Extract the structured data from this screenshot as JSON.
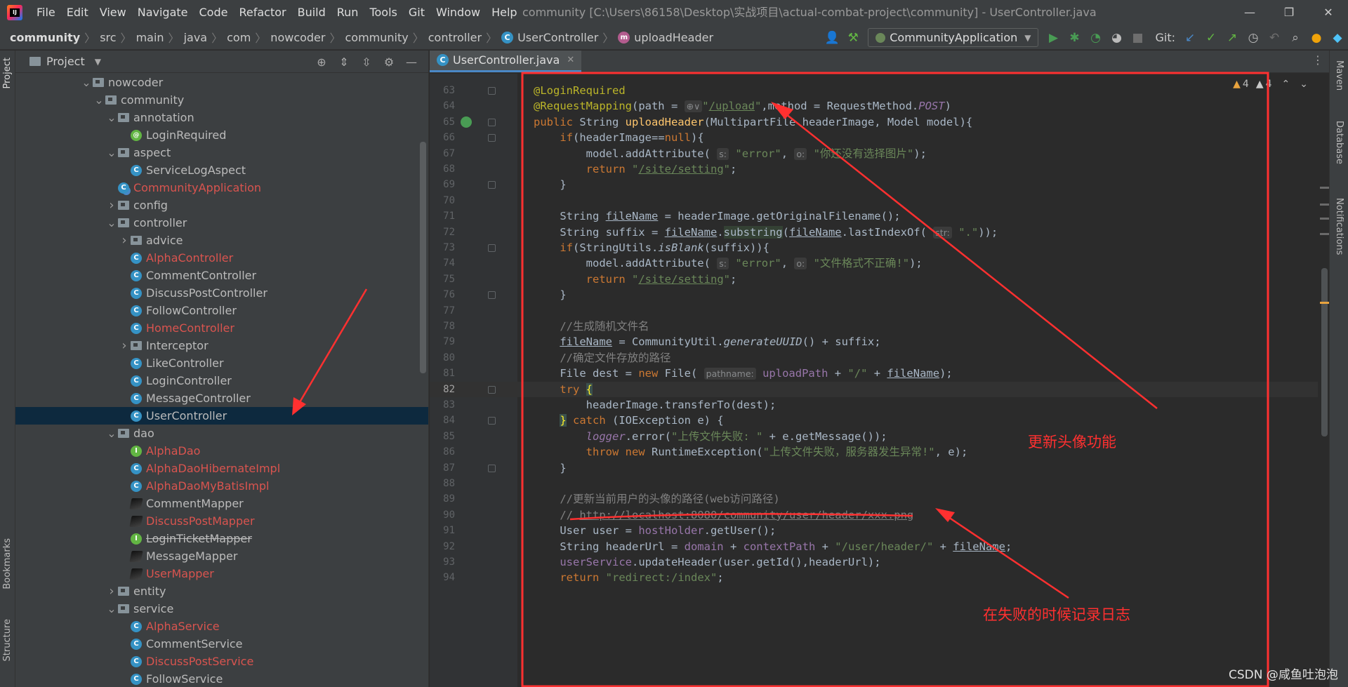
{
  "window": {
    "title": "community [C:\\Users\\86158\\Desktop\\实战项目\\actual-combat-project\\community] - UserController.java",
    "minimize": "—",
    "restore": "❐",
    "close": "✕"
  },
  "menu": [
    "File",
    "Edit",
    "View",
    "Navigate",
    "Code",
    "Refactor",
    "Build",
    "Run",
    "Tools",
    "Git",
    "Window",
    "Help"
  ],
  "breadcrumb": {
    "root": "community",
    "parts": [
      "src",
      "main",
      "java",
      "com",
      "nowcoder",
      "community",
      "controller"
    ],
    "class_name": "UserController",
    "method_name": "uploadHeader"
  },
  "toolbar": {
    "run_config": "CommunityApplication",
    "git_label": "Git:"
  },
  "stripes": {
    "project": "Project",
    "bookmarks": "Bookmarks",
    "structure": "Structure",
    "maven": "Maven",
    "database": "Database",
    "notifications": "Notifications"
  },
  "project_panel": {
    "title": "Project",
    "tree": [
      {
        "label": "nowcoder",
        "icon": "package",
        "depth": 0,
        "arrow": "open"
      },
      {
        "label": "community",
        "icon": "package",
        "depth": 1,
        "arrow": "open"
      },
      {
        "label": "annotation",
        "icon": "package",
        "depth": 2,
        "arrow": "open"
      },
      {
        "label": "LoginRequired",
        "icon": "annotation",
        "depth": 3,
        "arrow": "none"
      },
      {
        "label": "aspect",
        "icon": "package",
        "depth": 2,
        "arrow": "open"
      },
      {
        "label": "ServiceLogAspect",
        "icon": "class",
        "depth": 3,
        "arrow": "none"
      },
      {
        "label": "CommunityApplication",
        "icon": "app",
        "depth": 2,
        "arrow": "none",
        "modified": true
      },
      {
        "label": "config",
        "icon": "package",
        "depth": 2,
        "arrow": "closed"
      },
      {
        "label": "controller",
        "icon": "package",
        "depth": 2,
        "arrow": "open"
      },
      {
        "label": "advice",
        "icon": "package",
        "depth": 3,
        "arrow": "closed"
      },
      {
        "label": "AlphaController",
        "icon": "class",
        "depth": 3,
        "arrow": "none",
        "modified": true
      },
      {
        "label": "CommentController",
        "icon": "class",
        "depth": 3,
        "arrow": "none"
      },
      {
        "label": "DiscussPostController",
        "icon": "class",
        "depth": 3,
        "arrow": "none"
      },
      {
        "label": "FollowController",
        "icon": "class",
        "depth": 3,
        "arrow": "none"
      },
      {
        "label": "HomeController",
        "icon": "class",
        "depth": 3,
        "arrow": "none",
        "modified": true
      },
      {
        "label": "Interceptor",
        "icon": "package",
        "depth": 3,
        "arrow": "closed"
      },
      {
        "label": "LikeController",
        "icon": "class",
        "depth": 3,
        "arrow": "none"
      },
      {
        "label": "LoginController",
        "icon": "class",
        "depth": 3,
        "arrow": "none"
      },
      {
        "label": "MessageController",
        "icon": "class",
        "depth": 3,
        "arrow": "none"
      },
      {
        "label": "UserController",
        "icon": "class",
        "depth": 3,
        "arrow": "none",
        "selected": true
      },
      {
        "label": "dao",
        "icon": "package",
        "depth": 2,
        "arrow": "open"
      },
      {
        "label": "AlphaDao",
        "icon": "interface",
        "depth": 3,
        "arrow": "none",
        "modified": true
      },
      {
        "label": "AlphaDaoHibernateImpl",
        "icon": "class",
        "depth": 3,
        "arrow": "none",
        "modified": true
      },
      {
        "label": "AlphaDaoMyBatisImpl",
        "icon": "class",
        "depth": 3,
        "arrow": "none",
        "modified": true
      },
      {
        "label": "CommentMapper",
        "icon": "mapper",
        "depth": 3,
        "arrow": "none"
      },
      {
        "label": "DiscussPostMapper",
        "icon": "mapper",
        "depth": 3,
        "arrow": "none",
        "modified": true
      },
      {
        "label": "LoginTicketMapper",
        "icon": "interface",
        "depth": 3,
        "arrow": "none",
        "strike": true
      },
      {
        "label": "MessageMapper",
        "icon": "mapper",
        "depth": 3,
        "arrow": "none"
      },
      {
        "label": "UserMapper",
        "icon": "mapper",
        "depth": 3,
        "arrow": "none",
        "modified": true
      },
      {
        "label": "entity",
        "icon": "package",
        "depth": 2,
        "arrow": "closed"
      },
      {
        "label": "service",
        "icon": "package",
        "depth": 2,
        "arrow": "open"
      },
      {
        "label": "AlphaService",
        "icon": "class",
        "depth": 3,
        "arrow": "none",
        "modified": true
      },
      {
        "label": "CommentService",
        "icon": "class",
        "depth": 3,
        "arrow": "none"
      },
      {
        "label": "DiscussPostService",
        "icon": "class",
        "depth": 3,
        "arrow": "none",
        "modified": true
      },
      {
        "label": "FollowService",
        "icon": "class",
        "depth": 3,
        "arrow": "none"
      }
    ]
  },
  "editor": {
    "tab_label": "UserController.java",
    "warnings_a": "4",
    "warnings_b": "4",
    "current_line": "82",
    "lines": [
      {
        "n": "63",
        "html": "<span class=\"ann-c\">@LoginRequired</span>"
      },
      {
        "n": "64",
        "html": "<span class=\"ann-c\">@RequestMapping</span>(path = <span class=\"hint\">⊕∨</span><span class=\"str\">\"<span class=\"ul\">/upload</span>\"</span>,method = RequestMethod.<span class=\"fld ital\">POST</span>)"
      },
      {
        "n": "65",
        "html": "<span class=\"kw\">public</span> String <span class=\"fn\">uploadHeader</span>(MultipartFile headerImage, Model model){"
      },
      {
        "n": "66",
        "html": "    <span class=\"kw\">if</span>(headerImage==<span class=\"kw\">null</span>){"
      },
      {
        "n": "67",
        "html": "        model.addAttribute( <span class=\"hint\">s:</span> <span class=\"str\">\"error\"</span>, <span class=\"hint\">o:</span> <span class=\"str\">\"你还没有选择图片\"</span>);"
      },
      {
        "n": "68",
        "html": "        <span class=\"kw\">return</span> <span class=\"str\">\"<span class=\"ul\">/site/setting</span>\"</span>;"
      },
      {
        "n": "69",
        "html": "    }"
      },
      {
        "n": "70",
        "html": ""
      },
      {
        "n": "71",
        "html": "    String <span class=\"ul\">fileName</span> = headerImage.getOriginalFilename();"
      },
      {
        "n": "72",
        "html": "    String suffix = <span class=\"ul\">fileName</span>.<span class=\"hl-bg\">substring</span>(<span class=\"ul\">fileName</span>.lastIndexOf( <span class=\"hint\">str:</span> <span class=\"str\">\".\"</span>));"
      },
      {
        "n": "73",
        "html": "    <span class=\"kw\">if</span>(StringUtils.<span class=\"ital\">isBlank</span>(suffix)){"
      },
      {
        "n": "74",
        "html": "        model.addAttribute( <span class=\"hint\">s:</span> <span class=\"str\">\"error\"</span>, <span class=\"hint\">o:</span> <span class=\"str\">\"文件格式不正确!\"</span>);"
      },
      {
        "n": "75",
        "html": "        <span class=\"kw\">return</span> <span class=\"str\">\"<span class=\"ul\">/site/setting</span>\"</span>;"
      },
      {
        "n": "76",
        "html": "    }"
      },
      {
        "n": "77",
        "html": ""
      },
      {
        "n": "78",
        "html": "    <span class=\"cmt\">//生成随机文件名</span>"
      },
      {
        "n": "79",
        "html": "    <span class=\"ul\">fileName</span> = CommunityUtil.<span class=\"ital\">generateUUID</span>() + suffix;"
      },
      {
        "n": "80",
        "html": "    <span class=\"cmt\">//确定文件存放的路径</span>"
      },
      {
        "n": "81",
        "html": "    File dest = <span class=\"kw\">new</span> File( <span class=\"hint\">pathname:</span> <span class=\"fld\">uploadPath</span> + <span class=\"str\">\"/\"</span> + <span class=\"ul\">fileName</span>);"
      },
      {
        "n": "82",
        "html": "    <span class=\"kw\">try</span> <span class=\"brace-hl\">{</span>"
      },
      {
        "n": "83",
        "html": "        headerImage.transferTo(dest);"
      },
      {
        "n": "84",
        "html": "    <span class=\"brace-hl\">}</span> <span class=\"kw\">catch</span> (IOException e) {"
      },
      {
        "n": "85",
        "html": "        <span class=\"fld ital\">logger</span>.error(<span class=\"str\">\"上传文件失败: \"</span> + e.getMessage());"
      },
      {
        "n": "86",
        "html": "        <span class=\"kw\">throw new</span> RuntimeException(<span class=\"str\">\"上传文件失败，服务器发生异常!\"</span>, e);"
      },
      {
        "n": "87",
        "html": "    }"
      },
      {
        "n": "88",
        "html": ""
      },
      {
        "n": "89",
        "html": "    <span class=\"cmt\">//更新当前用户的头像的路径(web访问路径)</span>"
      },
      {
        "n": "90",
        "html": "    <span class=\"cmt\">// </span><span class=\"link-c\">http://localhost:8080/community/user/header/xxx.png</span>"
      },
      {
        "n": "91",
        "html": "    User user = <span class=\"fld\">hostHolder</span>.getUser();"
      },
      {
        "n": "92",
        "html": "    String headerUrl = <span class=\"fld\">domain</span> + <span class=\"fld\">contextPath</span> + <span class=\"str\">\"/user/header/\"</span> + <span class=\"ul\">fileName</span>;"
      },
      {
        "n": "93",
        "html": "    <span class=\"fld\">userService</span>.updateHeader(user.getId(),headerUrl);"
      },
      {
        "n": "94",
        "html": "    <span class=\"kw\">return</span> <span class=\"str\">\"redirect:/index\"</span>;"
      }
    ]
  },
  "annotations": {
    "note_feature": "更新头像功能",
    "note_log": "在失败的时候记录日志",
    "color": "#ff3030"
  },
  "watermark": "CSDN @咸鱼吐泡泡"
}
